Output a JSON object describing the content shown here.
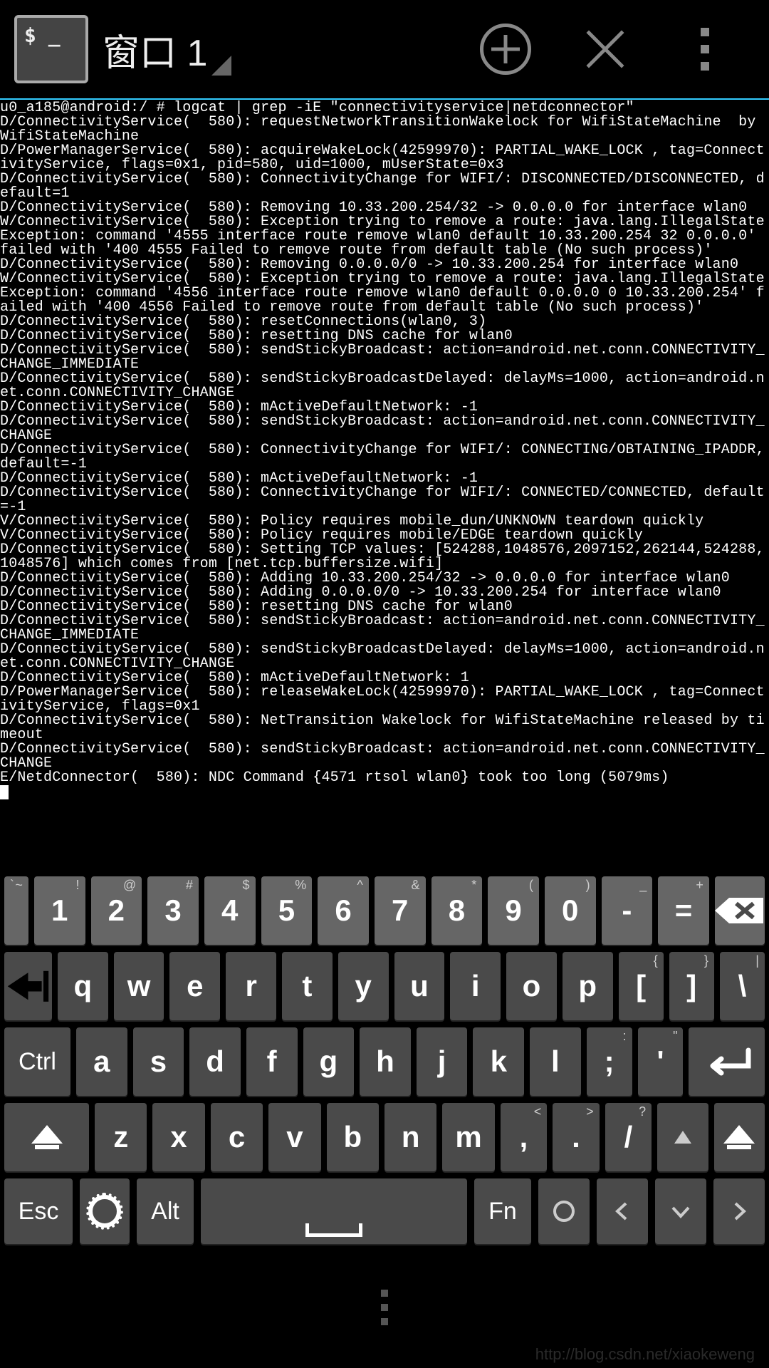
{
  "header": {
    "app_prompt": "$ _",
    "window_title": "窗口 1"
  },
  "terminal": {
    "lines": "u0_a185@android:/ # logcat | grep -iE \"connectivityservice|netdconnector\"\nD/ConnectivityService(  580): requestNetworkTransitionWakelock for WifiStateMachine  by WifiStateMachine\nD/PowerManagerService(  580): acquireWakeLock(42599970): PARTIAL_WAKE_LOCK , tag=ConnectivityService, flags=0x1, pid=580, uid=1000, mUserState=0x3\nD/ConnectivityService(  580): ConnectivityChange for WIFI/: DISCONNECTED/DISCONNECTED, default=1\nD/ConnectivityService(  580): Removing 10.33.200.254/32 -> 0.0.0.0 for interface wlan0\nW/ConnectivityService(  580): Exception trying to remove a route: java.lang.IllegalStateException: command '4555 interface route remove wlan0 default 10.33.200.254 32 0.0.0.0' failed with '400 4555 Failed to remove route from default table (No such process)'\nD/ConnectivityService(  580): Removing 0.0.0.0/0 -> 10.33.200.254 for interface wlan0\nW/ConnectivityService(  580): Exception trying to remove a route: java.lang.IllegalStateException: command '4556 interface route remove wlan0 default 0.0.0.0 0 10.33.200.254' failed with '400 4556 Failed to remove route from default table (No such process)'\nD/ConnectivityService(  580): resetConnections(wlan0, 3)\nD/ConnectivityService(  580): resetting DNS cache for wlan0\nD/ConnectivityService(  580): sendStickyBroadcast: action=android.net.conn.CONNECTIVITY_CHANGE_IMMEDIATE\nD/ConnectivityService(  580): sendStickyBroadcastDelayed: delayMs=1000, action=android.net.conn.CONNECTIVITY_CHANGE\nD/ConnectivityService(  580): mActiveDefaultNetwork: -1\nD/ConnectivityService(  580): sendStickyBroadcast: action=android.net.conn.CONNECTIVITY_CHANGE\nD/ConnectivityService(  580): ConnectivityChange for WIFI/: CONNECTING/OBTAINING_IPADDR, default=-1\nD/ConnectivityService(  580): mActiveDefaultNetwork: -1\nD/ConnectivityService(  580): ConnectivityChange for WIFI/: CONNECTED/CONNECTED, default=-1\nV/ConnectivityService(  580): Policy requires mobile_dun/UNKNOWN teardown quickly\nV/ConnectivityService(  580): Policy requires mobile/EDGE teardown quickly\nD/ConnectivityService(  580): Setting TCP values: [524288,1048576,2097152,262144,524288,1048576] which comes from [net.tcp.buffersize.wifi]\nD/ConnectivityService(  580): Adding 10.33.200.254/32 -> 0.0.0.0 for interface wlan0\nD/ConnectivityService(  580): Adding 0.0.0.0/0 -> 10.33.200.254 for interface wlan0\nD/ConnectivityService(  580): resetting DNS cache for wlan0\nD/ConnectivityService(  580): sendStickyBroadcast: action=android.net.conn.CONNECTIVITY_CHANGE_IMMEDIATE\nD/ConnectivityService(  580): sendStickyBroadcastDelayed: delayMs=1000, action=android.net.conn.CONNECTIVITY_CHANGE\nD/ConnectivityService(  580): mActiveDefaultNetwork: 1\nD/PowerManagerService(  580): releaseWakeLock(42599970): PARTIAL_WAKE_LOCK , tag=ConnectivityService, flags=0x1\nD/ConnectivityService(  580): NetTransition Wakelock for WifiStateMachine released by timeout\nD/ConnectivityService(  580): sendStickyBroadcast: action=android.net.conn.CONNECTIVITY_CHANGE\nE/NetdConnector(  580): NDC Command {4571 rtsol wlan0} took too long (5079ms)"
  },
  "keyboard": {
    "row1": [
      {
        "main": "",
        "sup": "~",
        "supL": "`"
      },
      {
        "main": "1",
        "sup": "!"
      },
      {
        "main": "2",
        "sup": "@"
      },
      {
        "main": "3",
        "sup": "#"
      },
      {
        "main": "4",
        "sup": "$"
      },
      {
        "main": "5",
        "sup": "%"
      },
      {
        "main": "6",
        "sup": "^"
      },
      {
        "main": "7",
        "sup": "&"
      },
      {
        "main": "8",
        "sup": "*"
      },
      {
        "main": "9",
        "sup": "("
      },
      {
        "main": "0",
        "sup": ")"
      },
      {
        "main": "-",
        "sup": "_"
      },
      {
        "main": "=",
        "sup": "+"
      }
    ],
    "row2": [
      "q",
      "w",
      "e",
      "r",
      "t",
      "y",
      "u",
      "i",
      "o",
      "p"
    ],
    "row2_tail": [
      {
        "main": "[",
        "sup": "{"
      },
      {
        "main": "]",
        "sup": "}"
      },
      {
        "main": "\\",
        "sup": "|"
      }
    ],
    "row3_lead": "Ctrl",
    "row3": [
      "a",
      "s",
      "d",
      "f",
      "g",
      "h",
      "j",
      "k",
      "l"
    ],
    "row3_tail": [
      {
        "main": ";",
        "sup": ":"
      },
      {
        "main": "'",
        "sup": "\""
      }
    ],
    "row4": [
      "z",
      "x",
      "c",
      "v",
      "b",
      "n",
      "m"
    ],
    "row4_tail": [
      {
        "main": ",",
        "sup": "<"
      },
      {
        "main": ".",
        "sup": ">"
      },
      {
        "main": "/",
        "sup": "?"
      }
    ],
    "nav": {
      "esc": "Esc",
      "alt": "Alt",
      "fn": "Fn"
    }
  },
  "watermark": "http://blog.csdn.net/xiaokeweng"
}
